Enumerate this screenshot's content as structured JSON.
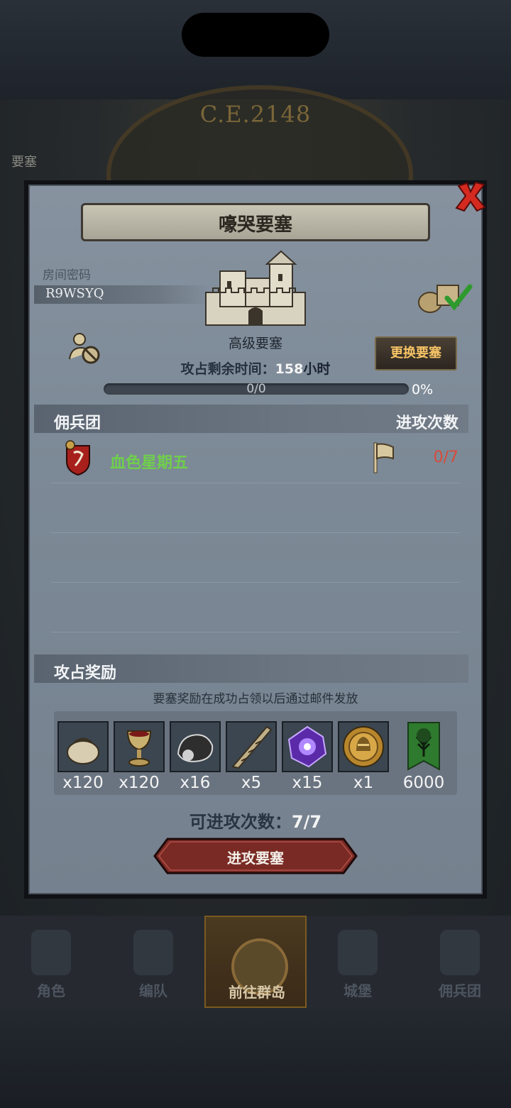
{
  "background": {
    "era": "C.E.2148",
    "label": "要塞"
  },
  "dialog": {
    "title": "嚎哭要塞",
    "room_label": "房间密码",
    "room_code": "R9WSYQ",
    "fortress_level": "高级要塞",
    "time_label": "攻占剩余时间：",
    "time_value": "158",
    "time_unit": "小时",
    "progress_text": "0/0",
    "progress_percent": "0%",
    "progress_fraction": 0,
    "change_button": "更换要塞",
    "mercenary_header": "佣兵团",
    "attack_count_header": "进攻次数",
    "mercenary": {
      "name": "血色星期五",
      "count": "0/7"
    },
    "reward_header": "攻占奖励",
    "reward_note": "要塞奖励在成功占领以后通过邮件发放",
    "rewards": [
      {
        "icon": "pouch-icon",
        "qty": "x120"
      },
      {
        "icon": "goblet-icon",
        "qty": "x120"
      },
      {
        "icon": "ore-icon",
        "qty": "x16"
      },
      {
        "icon": "horn-icon",
        "qty": "x5"
      },
      {
        "icon": "purple-crystal-icon",
        "qty": "x15"
      },
      {
        "icon": "helmet-medal-icon",
        "qty": "x1"
      },
      {
        "icon": "guild-banner-icon",
        "qty": "6000"
      }
    ],
    "attempts_label": "可进攻次数：",
    "attempts_value": "7/7",
    "attack_button": "进攻要塞"
  },
  "bottom_nav": [
    {
      "label": "角色",
      "icon": "knight-icon"
    },
    {
      "label": "编队",
      "icon": "helmet-icon"
    },
    {
      "label": "前往群岛",
      "icon": "island-map-icon",
      "active": true
    },
    {
      "label": "城堡",
      "icon": "castle-icon"
    },
    {
      "label": "佣兵团",
      "icon": "ship-icon"
    }
  ],
  "colors": {
    "panel": "#7f8b98",
    "gold_text": "#f6c466",
    "mercenary_green": "#6fcf4c",
    "count_red": "#d84a3a",
    "close_red": "#d42a20"
  }
}
